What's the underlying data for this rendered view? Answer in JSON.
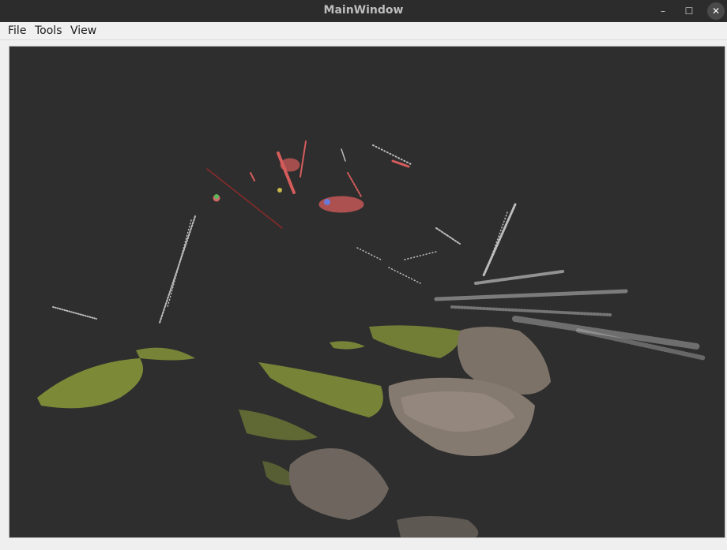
{
  "window": {
    "title": "MainWindow",
    "controls": {
      "minimize_icon": "minimize-icon",
      "maximize_icon": "maximize-icon",
      "close_icon": "close-icon",
      "minimize_glyph": "–",
      "maximize_glyph": "☐",
      "close_glyph": "✕"
    }
  },
  "menubar": {
    "items": [
      {
        "label": "File"
      },
      {
        "label": "Tools"
      },
      {
        "label": "View"
      }
    ]
  },
  "viewport": {
    "background": "#2e2e2e",
    "content": "3d-point-cloud",
    "colors": {
      "moss": "#8a9a3a",
      "rock": "#7a7068",
      "points_white": "#d8d8d8",
      "points_red": "#d05a5a"
    }
  }
}
